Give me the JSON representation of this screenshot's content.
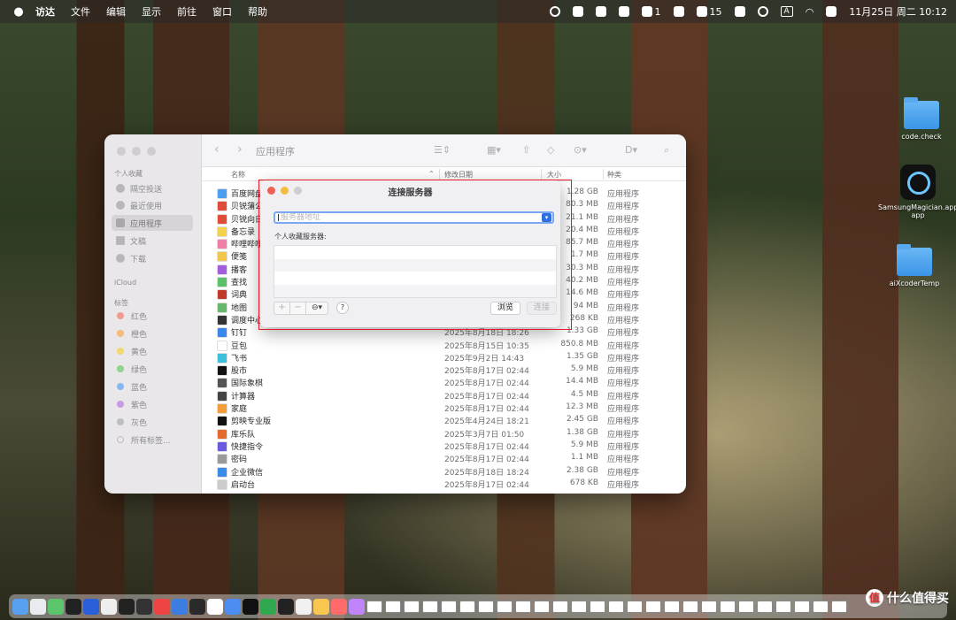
{
  "menubar": {
    "items": [
      "访达",
      "文件",
      "编辑",
      "显示",
      "前往",
      "窗口",
      "帮助"
    ],
    "tray": {
      "badge1": "1",
      "badge2": "15",
      "input_method": "A",
      "clock": "11月25日 周二  10:12"
    }
  },
  "finder": {
    "title": "应用程序",
    "sidebar": {
      "favorites_header": "个人收藏",
      "favorites": [
        "隔空投送",
        "最近使用",
        "应用程序",
        "文稿",
        "下载"
      ],
      "icloud_header": "iCloud",
      "tags_header": "标签",
      "tags": [
        {
          "label": "红色",
          "color": "#f2998f"
        },
        {
          "label": "橙色",
          "color": "#f5bb7a"
        },
        {
          "label": "黄色",
          "color": "#f3d86d"
        },
        {
          "label": "绿色",
          "color": "#8fd48d"
        },
        {
          "label": "蓝色",
          "color": "#86b7f0"
        },
        {
          "label": "紫色",
          "color": "#c79be3"
        },
        {
          "label": "灰色",
          "color": "#bdbcbf"
        }
      ],
      "all_tags": "所有标签..."
    },
    "columns": {
      "name": "名称",
      "date": "修改日期",
      "size": "大小",
      "kind": "种类"
    },
    "rows": [
      {
        "name": "百度网盘",
        "date": "",
        "size": "1.28 GB",
        "kind": "应用程序",
        "color": "#4b9ef0"
      },
      {
        "name": "贝锐蒲公",
        "date": "",
        "size": "80.3 MB",
        "kind": "应用程序",
        "color": "#e24a3a"
      },
      {
        "name": "贝锐向日",
        "date": "",
        "size": "21.1 MB",
        "kind": "应用程序",
        "color": "#e24a3a"
      },
      {
        "name": "备忘录",
        "date": "",
        "size": "20.4 MB",
        "kind": "应用程序",
        "color": "#f4d24a"
      },
      {
        "name": "哔哩哔哩",
        "date": "",
        "size": "85.7 MB",
        "kind": "应用程序",
        "color": "#f07fa8"
      },
      {
        "name": "便笺",
        "date": "",
        "size": "1.7 MB",
        "kind": "应用程序",
        "color": "#f2c64a"
      },
      {
        "name": "播客",
        "date": "",
        "size": "30.3 MB",
        "kind": "应用程序",
        "color": "#a35ee0"
      },
      {
        "name": "查找",
        "date": "",
        "size": "40.2 MB",
        "kind": "应用程序",
        "color": "#5bc06a"
      },
      {
        "name": "词典",
        "date": "",
        "size": "14.6 MB",
        "kind": "应用程序",
        "color": "#c0392b"
      },
      {
        "name": "地图",
        "date": "",
        "size": "94 MB",
        "kind": "应用程序",
        "color": "#64b96a"
      },
      {
        "name": "调度中心",
        "date": "",
        "size": "268 KB",
        "kind": "应用程序",
        "color": "#333333"
      },
      {
        "name": "钉钉",
        "date": "2025年8月18日 18:26",
        "size": "1.33 GB",
        "kind": "应用程序",
        "color": "#3a87f0"
      },
      {
        "name": "豆包",
        "date": "2025年8月15日 10:35",
        "size": "850.8 MB",
        "kind": "应用程序",
        "color": "#ffffff"
      },
      {
        "name": "飞书",
        "date": "2025年9月2日 14:43",
        "size": "1.35 GB",
        "kind": "应用程序",
        "color": "#3ac0d8"
      },
      {
        "name": "股市",
        "date": "2025年8月17日 02:44",
        "size": "5.9 MB",
        "kind": "应用程序",
        "color": "#111111"
      },
      {
        "name": "国际象棋",
        "date": "2025年8月17日 02:44",
        "size": "14.4 MB",
        "kind": "应用程序",
        "color": "#555555"
      },
      {
        "name": "计算器",
        "date": "2025年8月17日 02:44",
        "size": "4.5 MB",
        "kind": "应用程序",
        "color": "#444444"
      },
      {
        "name": "家庭",
        "date": "2025年8月17日 02:44",
        "size": "12.3 MB",
        "kind": "应用程序",
        "color": "#f39c3a"
      },
      {
        "name": "剪映专业版",
        "date": "2025年4月24日 18:21",
        "size": "2.45 GB",
        "kind": "应用程序",
        "color": "#111111"
      },
      {
        "name": "库乐队",
        "date": "2025年3月7日 01:50",
        "size": "1.38 GB",
        "kind": "应用程序",
        "color": "#e36a2a"
      },
      {
        "name": "快捷指令",
        "date": "2025年8月17日 02:44",
        "size": "5.9 MB",
        "kind": "应用程序",
        "color": "#6a5ae0"
      },
      {
        "name": "密码",
        "date": "2025年8月17日 02:44",
        "size": "1.1 MB",
        "kind": "应用程序",
        "color": "#9a9a9a"
      },
      {
        "name": "企业微信",
        "date": "2025年8月18日 18:24",
        "size": "2.38 GB",
        "kind": "应用程序",
        "color": "#3a8be8"
      },
      {
        "name": "启动台",
        "date": "2025年8月17日 02:44",
        "size": "678 KB",
        "kind": "应用程序",
        "color": "#cccccc"
      }
    ]
  },
  "dialog": {
    "title": "连接服务器",
    "address_placeholder": "服务器地址",
    "favorites_label": "个人收藏服务器:",
    "ctrl": [
      "+",
      "−",
      "⊖▾"
    ],
    "help": "?",
    "browse": "浏览",
    "connect": "连接"
  },
  "desktop": {
    "icons": [
      {
        "label": "code.check",
        "type": "folder"
      },
      {
        "label": "SamsungMagician.app",
        "type": "app"
      },
      {
        "label": "aiXcoderTemp",
        "type": "folder"
      }
    ]
  },
  "watermark": {
    "text": "什么值得买",
    "badge": "值"
  }
}
